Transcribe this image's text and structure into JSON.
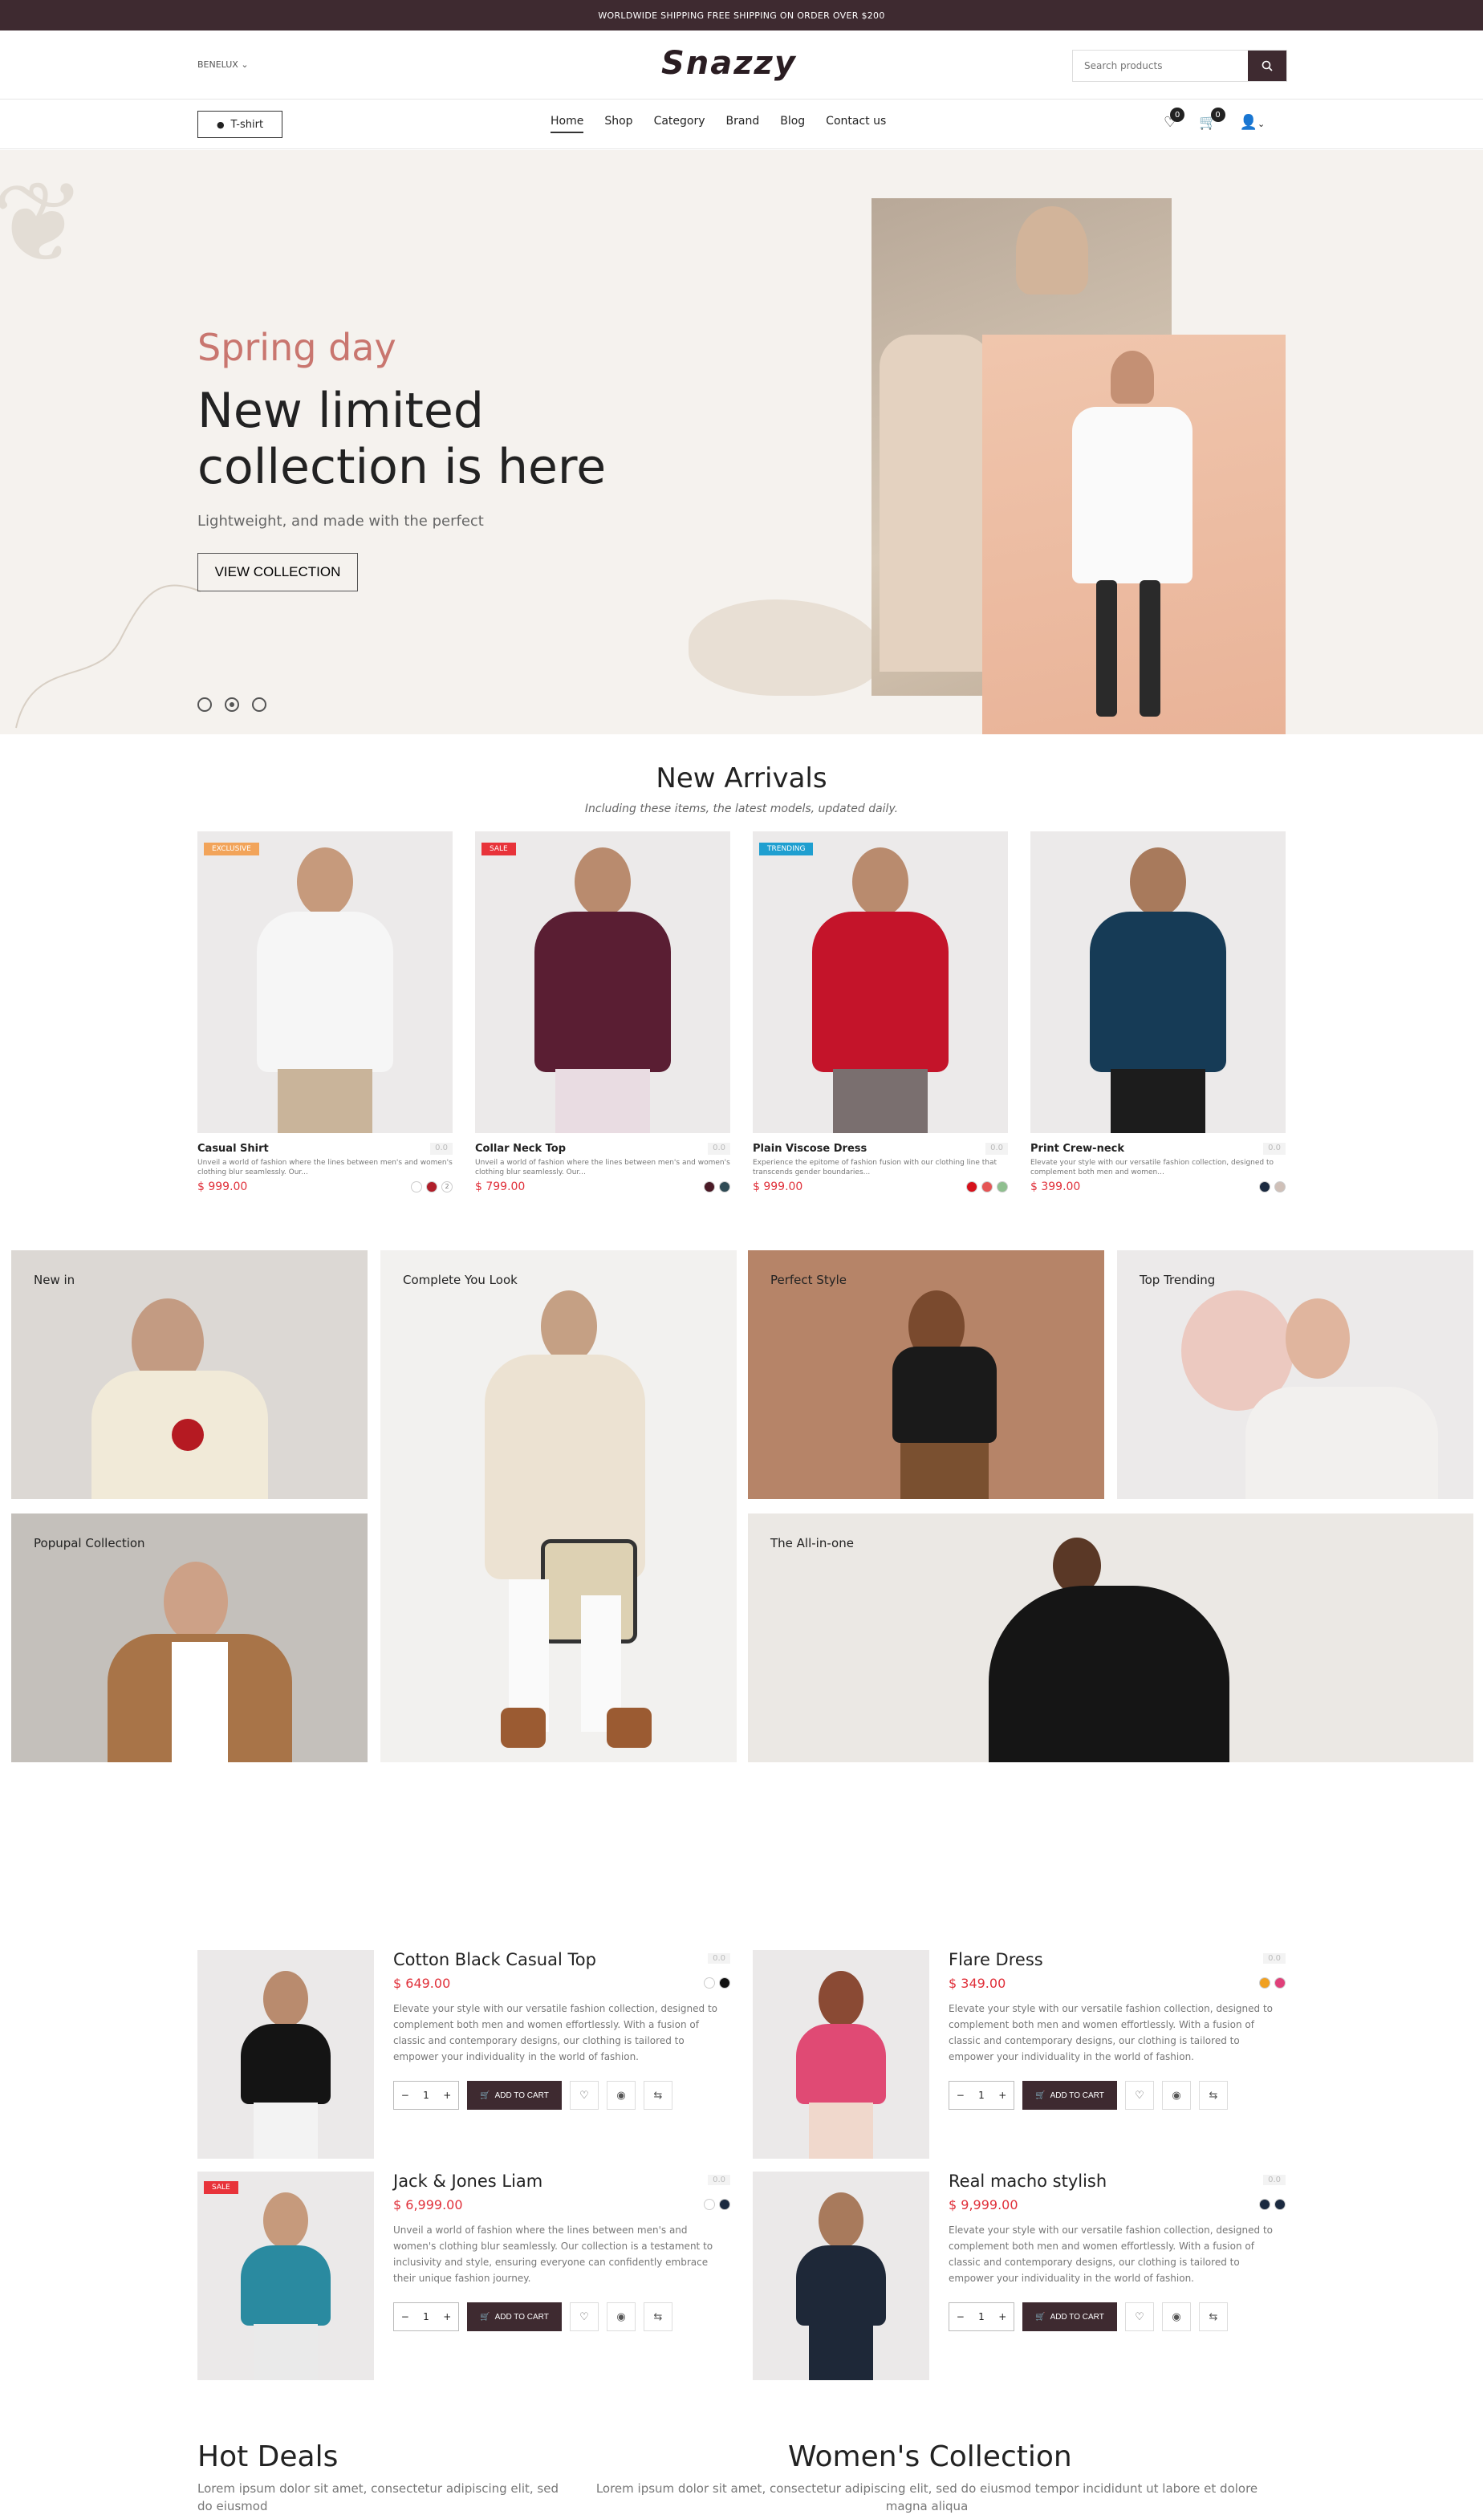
{
  "topbar": {
    "text": "WORLDWIDE SHIPPING FREE SHIPPING ON ORDER OVER $200"
  },
  "header": {
    "region": "BENELUX",
    "logo": "Snazzy",
    "search_placeholder": "Search products"
  },
  "nav": {
    "chip_label": "T-shirt",
    "items": [
      "Home",
      "Shop",
      "Category",
      "Brand",
      "Blog",
      "Contact us"
    ],
    "wishlist_count": "0",
    "cart_count": "0"
  },
  "hero": {
    "subtitle": "Spring day",
    "title": "New limited collection is here",
    "tagline": "Lightweight, and made with the perfect",
    "button": "VIEW COLLECTION"
  },
  "arrivals": {
    "title": "New Arrivals",
    "subtitle": "Including these items, the latest models, updated daily.",
    "products": [
      {
        "tag": "EXCLUSIVE",
        "tag_color": "#f2a45a",
        "name": "Casual Shirt",
        "rating": "0.0",
        "desc": "Unveil a world of fashion where the lines between men's and women's clothing blur seamlessly. Our...",
        "price": "$ 999.00",
        "swatches": [
          "#ffffff",
          "#b01e2a"
        ],
        "extra": "2"
      },
      {
        "tag": "SALE",
        "tag_color": "#e8333a",
        "name": "Collar Neck Top",
        "rating": "0.0",
        "desc": "Unveil a world of fashion where the lines between men's and women's clothing blur seamlessly. Our...",
        "price": "$ 799.00",
        "swatches": [
          "#4a1a26",
          "#2f4b55"
        ]
      },
      {
        "tag": "TRENDING",
        "tag_color": "#1f9fd0",
        "name": "Plain Viscose Dress",
        "rating": "0.0",
        "desc": "Experience the epitome of fashion fusion with our clothing line that transcends gender boundaries...",
        "price": "$ 999.00",
        "swatches": [
          "#d6111b",
          "#e55555",
          "#8fbf8f"
        ]
      },
      {
        "tag": "",
        "tag_color": "",
        "name": "Print Crew-neck",
        "rating": "0.0",
        "desc": "Elevate your style with our versatile fashion collection, designed to complement both men and women...",
        "price": "$ 399.00",
        "swatches": [
          "#1b2a40",
          "#cfc0b8"
        ]
      }
    ]
  },
  "collections": {
    "new_in": "New in",
    "complete": "Complete You Look",
    "perfect": "Perfect Style",
    "trending": "Top Trending",
    "popular": "Popupal Collection",
    "allinone": "The All-in-one"
  },
  "featured": {
    "add_to_cart": "ADD TO CART",
    "qty": "1",
    "items": [
      {
        "name": "Cotton Black Casual Top",
        "price": "$ 649.00",
        "rating": "0.0",
        "text": "Elevate your style with our versatile fashion collection, designed to complement both men and women effortlessly. With a fusion of classic and contemporary designs, our clothing is tailored to empower your individuality in the world of fashion.",
        "swatches": [
          "#ffffff",
          "#111111"
        ],
        "sale": ""
      },
      {
        "name": "Flare Dress",
        "price": "$ 349.00",
        "rating": "0.0",
        "text": "Elevate your style with our versatile fashion collection, designed to complement both men and women effortlessly. With a fusion of classic and contemporary designs, our clothing is tailored to empower your individuality in the world of fashion.",
        "swatches": [
          "#f0a020",
          "#e0407a"
        ],
        "sale": ""
      },
      {
        "name": "Jack & Jones Liam",
        "price": "$ 6,999.00",
        "rating": "0.0",
        "text": "Unveil a world of fashion where the lines between men's and women's clothing blur seamlessly. Our collection is a testament to inclusivity and style, ensuring everyone can confidently embrace their unique fashion journey.",
        "swatches": [
          "#ffffff",
          "#1b2a40"
        ],
        "sale": "SALE"
      },
      {
        "name": "Real macho stylish",
        "price": "$ 9,999.00",
        "rating": "0.0",
        "text": "Elevate your style with our versatile fashion collection, designed to complement both men and women effortlessly. With a fusion of classic and contemporary designs, our clothing is tailored to empower your individuality in the world of fashion.",
        "swatches": [
          "#1b2a40",
          "#1b2a40"
        ],
        "sale": ""
      }
    ]
  },
  "bottom": {
    "hot_title": "Hot Deals",
    "hot_text": "Lorem ipsum dolor sit amet, consectetur adipiscing elit, sed do eiusmod",
    "women_title": "Women's Collection",
    "women_text": "Lorem ipsum dolor sit amet, consectetur adipiscing elit, sed do eiusmod tempor incididunt ut labore et dolore magna aliqua"
  }
}
